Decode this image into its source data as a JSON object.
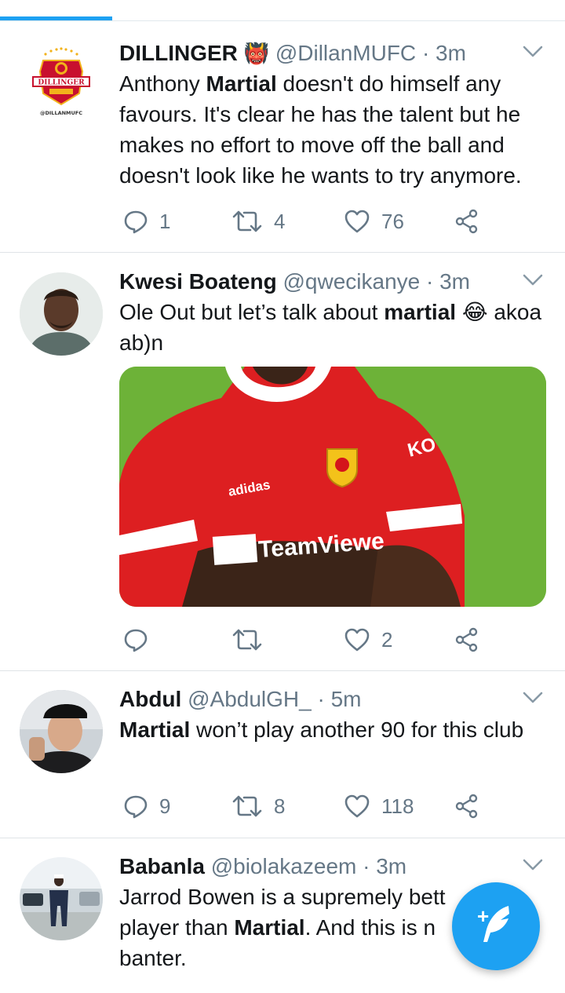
{
  "colors": {
    "accent": "#1da1f2",
    "muted": "#657786",
    "divider": "#e1e8ed"
  },
  "tweets": [
    {
      "name": "DILLINGER",
      "name_emoji": "👹",
      "handle": "@DillanMUFC",
      "sep": "·",
      "time": "3m",
      "text_parts": [
        "Anthony ",
        "Martial",
        " doesn't do himself any favours. It's clear he has the talent but he makes no effort to move off the ball and doesn't look like he wants to try anymore."
      ],
      "replies": "1",
      "retweets": "4",
      "likes": "76",
      "avatar_logo": "DILLINGER",
      "avatar_caption": "@DILLANMUFC"
    },
    {
      "name": "Kwesi Boateng",
      "handle": "@qwecikanye",
      "sep": "·",
      "time": "3m",
      "text_parts": [
        "Ole Out but let’s talk about ",
        "martial",
        " 😂 akoa ab)n"
      ],
      "replies": "",
      "retweets": "",
      "likes": "2",
      "media_jersey_text": [
        "adidas",
        "TeamViewe",
        "KO"
      ]
    },
    {
      "name": "Abdul",
      "handle": "@AbdulGH_",
      "sep": "·",
      "time": "5m",
      "text_parts": [
        "",
        "Martial",
        " won’t play another 90 for this club"
      ],
      "replies": "9",
      "retweets": "8",
      "likes": "118"
    },
    {
      "name": "Babanla",
      "handle": "@biolakazeem",
      "sep": "·",
      "time": "3m",
      "text_parts": [
        "Jarrod Bowen is a supremely bett player than ",
        "Martial",
        ". And this is n banter."
      ],
      "replies": "",
      "retweets": "",
      "likes": ""
    }
  ],
  "fab": {
    "label": "+",
    "icon": "feather-icon"
  }
}
